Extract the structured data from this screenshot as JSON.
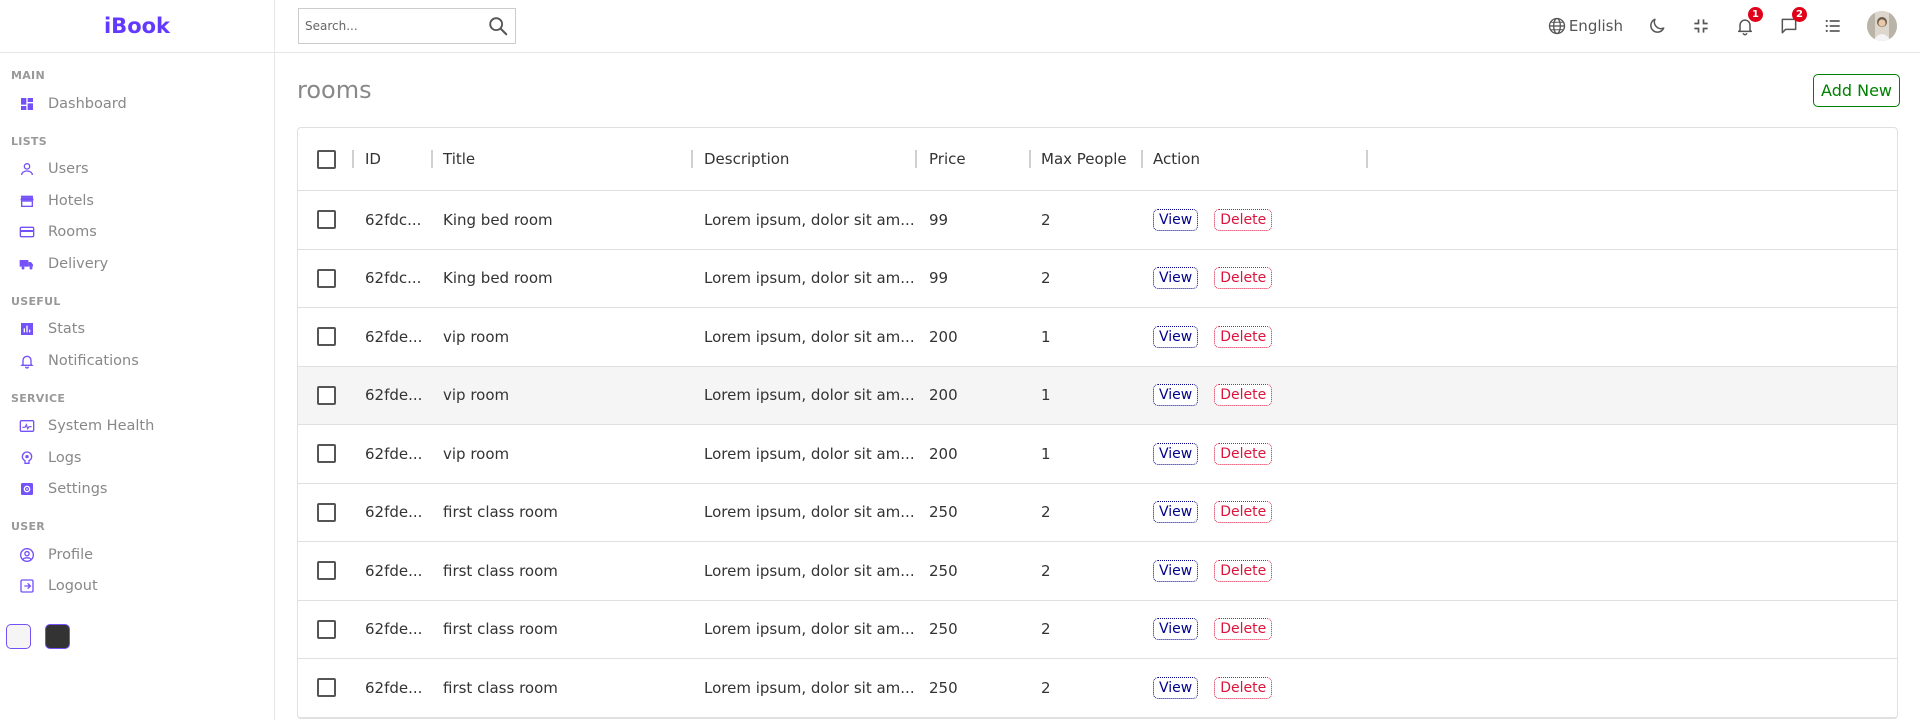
{
  "app": {
    "logo": "iBook"
  },
  "sidebar": {
    "sections": [
      {
        "title": "MAIN",
        "items": [
          {
            "label": "Dashboard",
            "icon": "dashboard-icon"
          }
        ]
      },
      {
        "title": "LISTS",
        "items": [
          {
            "label": "Users",
            "icon": "user-icon"
          },
          {
            "label": "Hotels",
            "icon": "store-icon"
          },
          {
            "label": "Rooms",
            "icon": "credit-card-icon"
          },
          {
            "label": "Delivery",
            "icon": "truck-icon"
          }
        ]
      },
      {
        "title": "USEFUL",
        "items": [
          {
            "label": "Stats",
            "icon": "chart-icon"
          },
          {
            "label": "Notifications",
            "icon": "bell-icon"
          }
        ]
      },
      {
        "title": "SERVICE",
        "items": [
          {
            "label": "System Health",
            "icon": "health-icon"
          },
          {
            "label": "Logs",
            "icon": "psychology-icon"
          },
          {
            "label": "Settings",
            "icon": "settings-icon"
          }
        ]
      },
      {
        "title": "USER",
        "items": [
          {
            "label": "Profile",
            "icon": "profile-icon"
          },
          {
            "label": "Logout",
            "icon": "logout-icon"
          }
        ]
      }
    ]
  },
  "navbar": {
    "search_placeholder": "Search...",
    "language": "English",
    "notifications_count": "1",
    "messages_count": "2"
  },
  "main": {
    "title": "rooms",
    "add_new": "Add New"
  },
  "grid": {
    "columns": [
      "ID",
      "Title",
      "Description",
      "Price",
      "Max People",
      "Action"
    ],
    "view_label": "View",
    "delete_label": "Delete",
    "rows": [
      {
        "id": "62fdc...",
        "title": "King bed room",
        "desc": "Lorem ipsum, dolor sit am...",
        "price": "99",
        "max": "2"
      },
      {
        "id": "62fdc...",
        "title": "King bed room",
        "desc": "Lorem ipsum, dolor sit am...",
        "price": "99",
        "max": "2"
      },
      {
        "id": "62fde...",
        "title": "vip room",
        "desc": "Lorem ipsum, dolor sit am...",
        "price": "200",
        "max": "1"
      },
      {
        "id": "62fde...",
        "title": "vip room",
        "desc": "Lorem ipsum, dolor sit am...",
        "price": "200",
        "max": "1"
      },
      {
        "id": "62fde...",
        "title": "vip room",
        "desc": "Lorem ipsum, dolor sit am...",
        "price": "200",
        "max": "1"
      },
      {
        "id": "62fde...",
        "title": "first class room",
        "desc": "Lorem ipsum, dolor sit am...",
        "price": "250",
        "max": "2"
      },
      {
        "id": "62fde...",
        "title": "first class room",
        "desc": "Lorem ipsum, dolor sit am...",
        "price": "250",
        "max": "2"
      },
      {
        "id": "62fde...",
        "title": "first class room",
        "desc": "Lorem ipsum, dolor sit am...",
        "price": "250",
        "max": "2"
      },
      {
        "id": "62fde...",
        "title": "first class room",
        "desc": "Lorem ipsum, dolor sit am...",
        "price": "250",
        "max": "2"
      }
    ]
  },
  "colors": {
    "accent": "#7451f8",
    "logo": "#6439ff",
    "add_new": "#008000",
    "view": "#00008b",
    "delete": "#dc143c",
    "badge": "#e0001a"
  }
}
